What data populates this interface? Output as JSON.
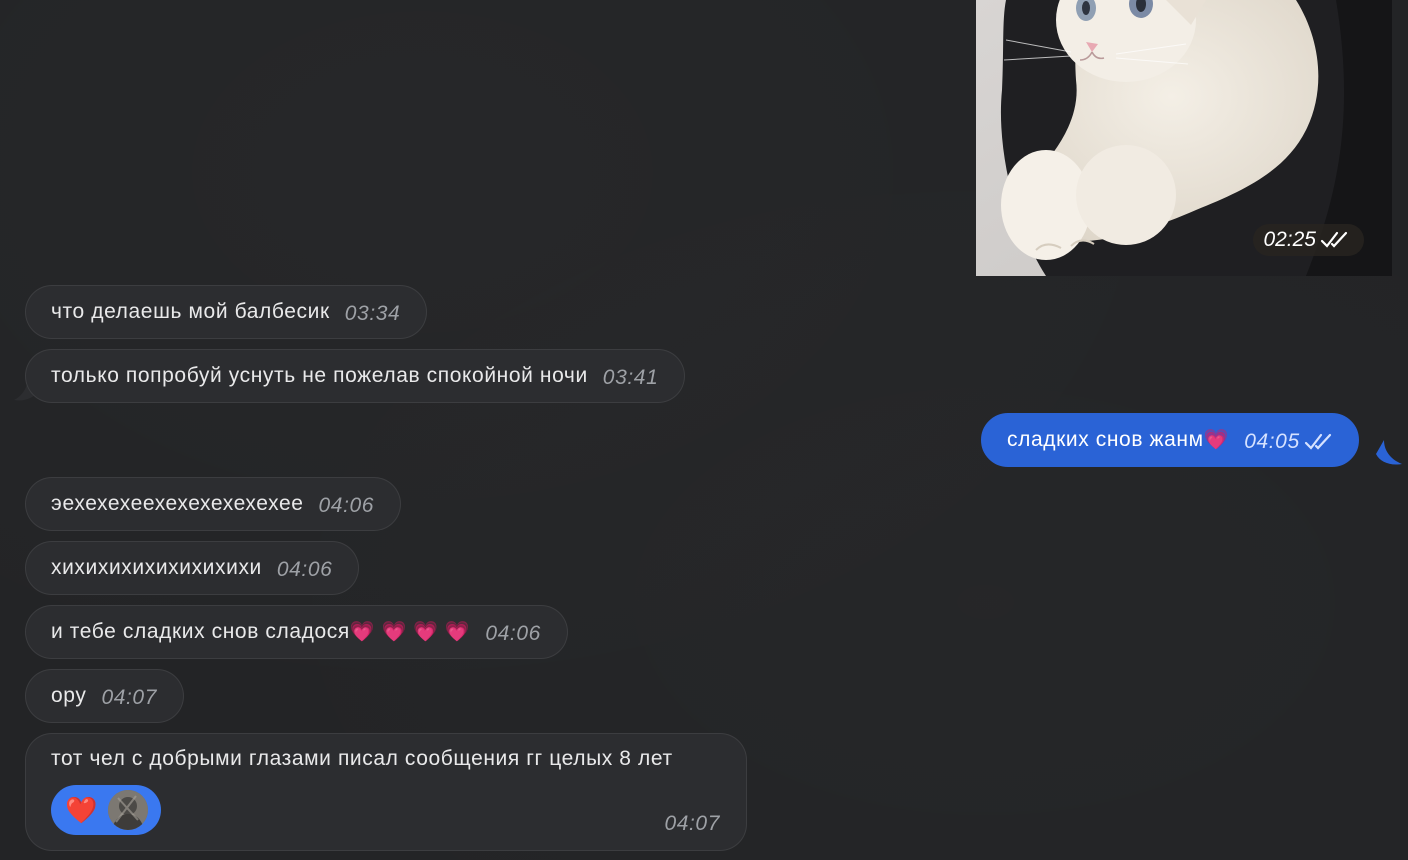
{
  "photo_message": {
    "time": "02:25",
    "status_icon": "double-check-icon"
  },
  "messages": [
    {
      "text": "что делаешь мой балбесик",
      "time": "03:34",
      "direction": "in"
    },
    {
      "text": "только попробуй уснуть не пожелав спокойной ночи",
      "time": "03:41",
      "direction": "in"
    },
    {
      "text": "сладких снов жанм",
      "time": "04:05",
      "direction": "out",
      "emoji": "💗"
    },
    {
      "text": "эехехехеехехехехехехее",
      "time": "04:06",
      "direction": "in"
    },
    {
      "text": "хихихихихихихихихи",
      "time": "04:06",
      "direction": "in"
    },
    {
      "text": "и тебе сладких снов сладося",
      "time": "04:06",
      "direction": "in",
      "emoji": "💗 💗 💗 💗"
    },
    {
      "text": "ору",
      "time": "04:07",
      "direction": "in"
    },
    {
      "text": "тот чел с добрыми глазами писал сообщения гг целых 8 лет",
      "time": "04:07",
      "direction": "in",
      "reaction": "❤️"
    }
  ],
  "colors": {
    "background": "#232426",
    "incoming_bubble": "#2c2d30",
    "outgoing_bubble": "#2a63d6",
    "reaction_pill": "#3a78f0"
  }
}
